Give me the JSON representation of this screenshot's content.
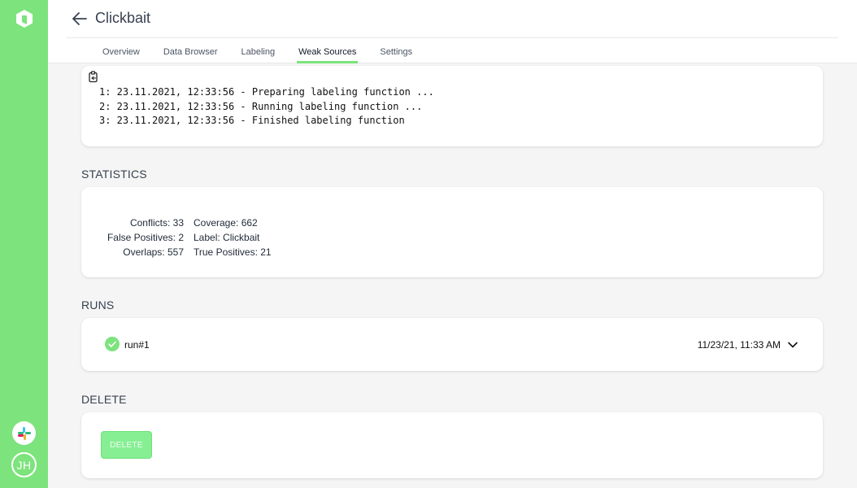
{
  "app": {
    "title": "Clickbait",
    "user_initials": "JH"
  },
  "tabs": [
    {
      "label": "Overview"
    },
    {
      "label": "Data Browser"
    },
    {
      "label": "Labeling"
    },
    {
      "label": "Weak Sources",
      "active": true
    },
    {
      "label": "Settings"
    }
  ],
  "log": {
    "lines": [
      "1: 23.11.2021, 12:33:56 - Preparing labeling function ...",
      "2: 23.11.2021, 12:33:56 - Running labeling function ...",
      "3: 23.11.2021, 12:33:56 - Finished labeling function"
    ]
  },
  "statistics": {
    "heading": "STATISTICS",
    "left": [
      "Conflicts: 33",
      "False Positives: 2",
      "Overlaps: 557"
    ],
    "right": [
      "Coverage: 662",
      "Label: Clickbait",
      "True Positives: 21"
    ]
  },
  "runs": {
    "heading": "RUNS",
    "items": [
      {
        "name": "run#1",
        "date": "11/23/21, 11:33 AM",
        "status": "success"
      }
    ]
  },
  "delete": {
    "heading": "DELETE",
    "button_label": "DELETE"
  },
  "colors": {
    "brand_green": "#7de37d",
    "delete_button": "#86ef93",
    "success": "#7de37d"
  }
}
